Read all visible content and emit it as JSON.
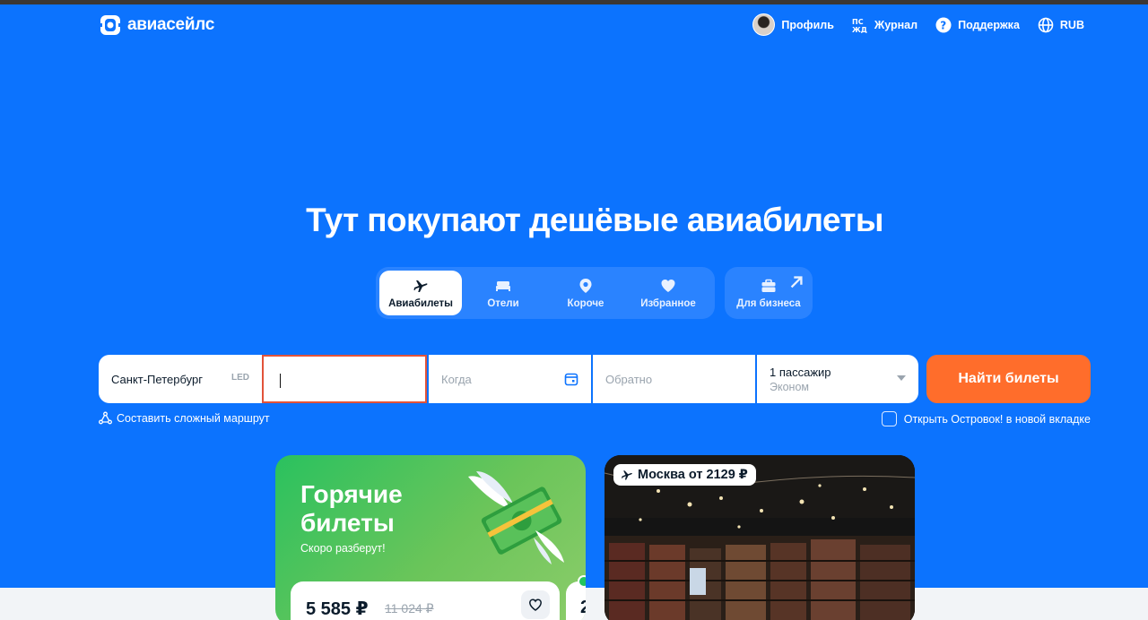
{
  "header": {
    "logo_text": "авиасейлс",
    "nav": [
      {
        "label": "Профиль",
        "icon": "avatar"
      },
      {
        "label": "Журнал",
        "icon": "journal-icon"
      },
      {
        "label": "Поддержка",
        "icon": "help-icon"
      },
      {
        "label": "RUB",
        "icon": "globe-icon"
      }
    ]
  },
  "hero": {
    "title": "Тут покупают дешёвые авиабилеты"
  },
  "tabs": [
    {
      "label": "Авиабилеты",
      "icon": "plane-icon",
      "active": true
    },
    {
      "label": "Отели",
      "icon": "bed-icon",
      "active": false
    },
    {
      "label": "Короче",
      "icon": "pin-icon",
      "active": false
    },
    {
      "label": "Избранное",
      "icon": "heart-icon",
      "active": false
    }
  ],
  "business_tab": {
    "label": "Для бизнеса",
    "icon": "briefcase-icon"
  },
  "search": {
    "from_value": "Санкт-Петербург",
    "from_code": "LED",
    "to_value": "",
    "when_placeholder": "Когда",
    "back_placeholder": "Обратно",
    "passengers": "1 пассажир",
    "cabin_class": "Эконом",
    "submit_label": "Найти билеты"
  },
  "links": {
    "complex_route": "Составить сложный маршрут",
    "open_ostrovok": "Открыть Островок! в новой вкладке",
    "open_ostrovok_checked": false
  },
  "hot_card": {
    "title": "Горячие билеты",
    "subtitle": "Скоро разберут!",
    "price": "5 585 ₽",
    "old_price": "11 024 ₽",
    "next_price_partial": "2"
  },
  "moscow_card": {
    "badge": "Москва от 2129 ₽"
  },
  "colors": {
    "brand_blue": "#0c73fe",
    "accent_orange": "#ff6d2b",
    "active_field_border": "#e2533a",
    "hot_green": "#2ac15f"
  }
}
